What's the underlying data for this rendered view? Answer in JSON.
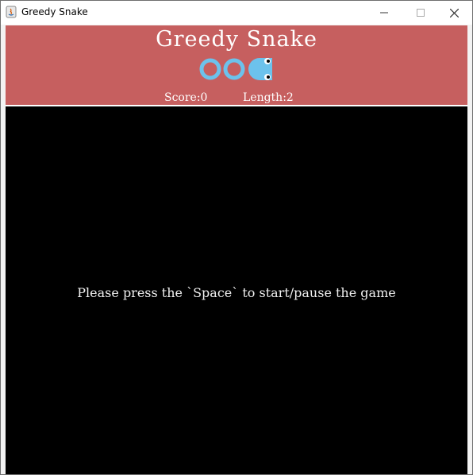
{
  "window": {
    "title": "Greedy Snake",
    "controls": {
      "minimize": "—",
      "maximize": "☐",
      "close": "✕"
    }
  },
  "header": {
    "title": "Greedy Snake",
    "logo_icon": "snake-logo-icon",
    "score_label": "Score:0",
    "length_label": "Length:2"
  },
  "board": {
    "message": "Please press the `Space` to start/pause the game"
  },
  "colors": {
    "header_bg": "#c65f5f",
    "board_bg": "#000000",
    "snake": "#6cc2ec"
  }
}
